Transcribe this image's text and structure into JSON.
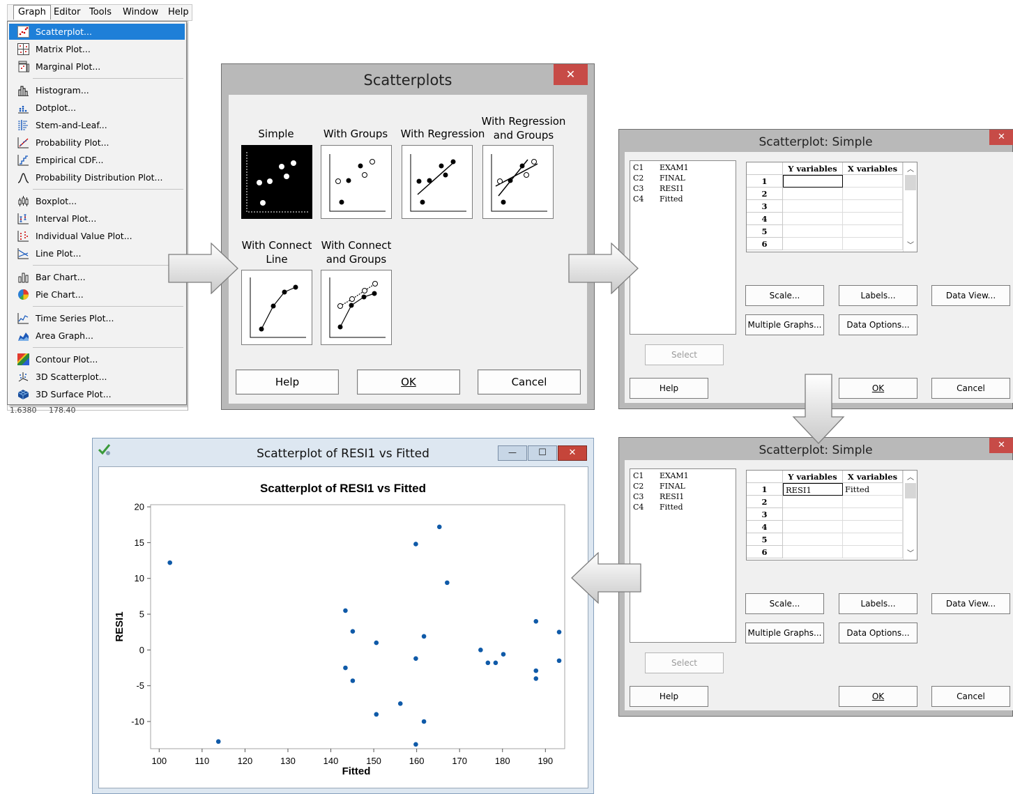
{
  "menubar": {
    "items": [
      "Graph",
      "Editor",
      "Tools",
      "Window",
      "Help"
    ]
  },
  "graph_menu": {
    "items": [
      {
        "label": "Scatterplot...",
        "icon": "scatterplot-icon",
        "selected": true
      },
      {
        "label": "Matrix Plot...",
        "icon": "matrix-plot-icon"
      },
      {
        "label": "Marginal Plot...",
        "icon": "marginal-plot-icon"
      },
      {
        "label": "Histogram...",
        "icon": "histogram-icon"
      },
      {
        "label": "Dotplot...",
        "icon": "dotplot-icon"
      },
      {
        "label": "Stem-and-Leaf...",
        "icon": "stem-and-leaf-icon"
      },
      {
        "label": "Probability Plot...",
        "icon": "probability-plot-icon"
      },
      {
        "label": "Empirical CDF...",
        "icon": "empirical-cdf-icon"
      },
      {
        "label": "Probability Distribution Plot...",
        "icon": "distribution-curve-icon"
      },
      {
        "label": "Boxplot...",
        "icon": "boxplot-icon"
      },
      {
        "label": "Interval Plot...",
        "icon": "interval-plot-icon"
      },
      {
        "label": "Individual Value Plot...",
        "icon": "individual-value-plot-icon"
      },
      {
        "label": "Line Plot...",
        "icon": "line-plot-icon"
      },
      {
        "label": "Bar Chart...",
        "icon": "bar-chart-icon"
      },
      {
        "label": "Pie Chart...",
        "icon": "pie-chart-icon"
      },
      {
        "label": "Time Series Plot...",
        "icon": "time-series-icon"
      },
      {
        "label": "Area Graph...",
        "icon": "area-graph-icon"
      },
      {
        "label": "Contour Plot...",
        "icon": "contour-plot-icon"
      },
      {
        "label": "3D Scatterplot...",
        "icon": "3d-scatterplot-icon"
      },
      {
        "label": "3D Surface Plot...",
        "icon": "3d-surface-icon"
      }
    ],
    "partial_text_below": "1.6380     178.40"
  },
  "scatterplots_dialog": {
    "title": "Scatterplots",
    "close": "✕",
    "options": [
      {
        "label": "Simple",
        "selected": true
      },
      {
        "label": "With Groups"
      },
      {
        "label": "With Regression"
      },
      {
        "label": "With Regression and Groups"
      },
      {
        "label": "With Connect Line"
      },
      {
        "label": "With Connect and Groups"
      }
    ],
    "labels": {
      "simple": "Simple",
      "groups": "With Groups",
      "regression": "With Regression",
      "reg_groups_1": "With Regression",
      "reg_groups_2": "and Groups",
      "connect_1": "With Connect",
      "connect_2": "Line",
      "connect_groups_1": "With Connect",
      "connect_groups_2": "and Groups"
    },
    "buttons": {
      "help": "Help",
      "ok": "OK",
      "cancel": "Cancel"
    }
  },
  "simple_dialog_1": {
    "title": "Scatterplot: Simple",
    "close": "✕",
    "columns": [
      {
        "id": "C1",
        "name": "EXAM1"
      },
      {
        "id": "C2",
        "name": "FINAL"
      },
      {
        "id": "C3",
        "name": "RESI1"
      },
      {
        "id": "C4",
        "name": "Fitted"
      }
    ],
    "table_headers": [
      "Y variables",
      "X variables"
    ],
    "rows": [
      {
        "n": "1",
        "y": "",
        "x": ""
      },
      {
        "n": "2",
        "y": "",
        "x": ""
      },
      {
        "n": "3",
        "y": "",
        "x": ""
      },
      {
        "n": "4",
        "y": "",
        "x": ""
      },
      {
        "n": "5",
        "y": "",
        "x": ""
      },
      {
        "n": "6",
        "y": "",
        "x": ""
      }
    ],
    "buttons": {
      "scale": "Scale...",
      "labels": "Labels...",
      "data_view": "Data View...",
      "multiple_graphs": "Multiple Graphs...",
      "data_options": "Data Options...",
      "select": "Select",
      "help": "Help",
      "ok": "OK",
      "cancel": "Cancel"
    }
  },
  "simple_dialog_2": {
    "title": "Scatterplot: Simple",
    "close": "✕",
    "columns": [
      {
        "id": "C1",
        "name": "EXAM1"
      },
      {
        "id": "C2",
        "name": "FINAL"
      },
      {
        "id": "C3",
        "name": "RESI1"
      },
      {
        "id": "C4",
        "name": "Fitted"
      }
    ],
    "table_headers": [
      "Y variables",
      "X variables"
    ],
    "rows": [
      {
        "n": "1",
        "y": "RESI1",
        "x": "Fitted"
      },
      {
        "n": "2",
        "y": "",
        "x": ""
      },
      {
        "n": "3",
        "y": "",
        "x": ""
      },
      {
        "n": "4",
        "y": "",
        "x": ""
      },
      {
        "n": "5",
        "y": "",
        "x": ""
      },
      {
        "n": "6",
        "y": "",
        "x": ""
      }
    ],
    "buttons": {
      "scale": "Scale...",
      "labels": "Labels...",
      "data_view": "Data View...",
      "multiple_graphs": "Multiple Graphs...",
      "data_options": "Data Options...",
      "select": "Select",
      "help": "Help",
      "ok": "OK",
      "cancel": "Cancel"
    }
  },
  "graph_window": {
    "title": "Scatterplot of RESI1 vs Fitted",
    "controls": {
      "minimize": "—",
      "maximize": "☐",
      "close": "✕"
    }
  },
  "chart_data": {
    "type": "scatter",
    "title": "Scatterplot of RESI1 vs Fitted",
    "xlabel": "Fitted",
    "ylabel": "RESI1",
    "xlim": [
      98,
      194.5
    ],
    "ylim": [
      -13.8,
      20.3
    ],
    "xticks": [
      100,
      110,
      120,
      130,
      140,
      150,
      160,
      170,
      180,
      190
    ],
    "yticks": [
      20,
      15,
      10,
      5,
      0,
      -5,
      -10
    ],
    "color": "#0f5aa8",
    "points": [
      {
        "x": 102.5,
        "y": 12.2
      },
      {
        "x": 113.8,
        "y": -12.8
      },
      {
        "x": 143.4,
        "y": 5.5
      },
      {
        "x": 143.4,
        "y": -2.5
      },
      {
        "x": 145.1,
        "y": 2.6
      },
      {
        "x": 145.1,
        "y": -4.3
      },
      {
        "x": 150.6,
        "y": 1.0
      },
      {
        "x": 150.6,
        "y": -9.0
      },
      {
        "x": 156.2,
        "y": -7.5
      },
      {
        "x": 159.8,
        "y": 14.8
      },
      {
        "x": 159.8,
        "y": -1.2
      },
      {
        "x": 159.8,
        "y": -13.2
      },
      {
        "x": 161.7,
        "y": 1.9
      },
      {
        "x": 161.7,
        "y": -10.0
      },
      {
        "x": 165.3,
        "y": 17.2
      },
      {
        "x": 167.1,
        "y": 9.4
      },
      {
        "x": 174.9,
        "y": 0.0
      },
      {
        "x": 176.6,
        "y": -1.8
      },
      {
        "x": 178.4,
        "y": -1.8
      },
      {
        "x": 180.2,
        "y": -0.6
      },
      {
        "x": 187.8,
        "y": 4.0
      },
      {
        "x": 187.8,
        "y": -2.9
      },
      {
        "x": 187.8,
        "y": -4.0
      },
      {
        "x": 193.2,
        "y": 2.5
      },
      {
        "x": 193.2,
        "y": -1.5
      }
    ]
  }
}
